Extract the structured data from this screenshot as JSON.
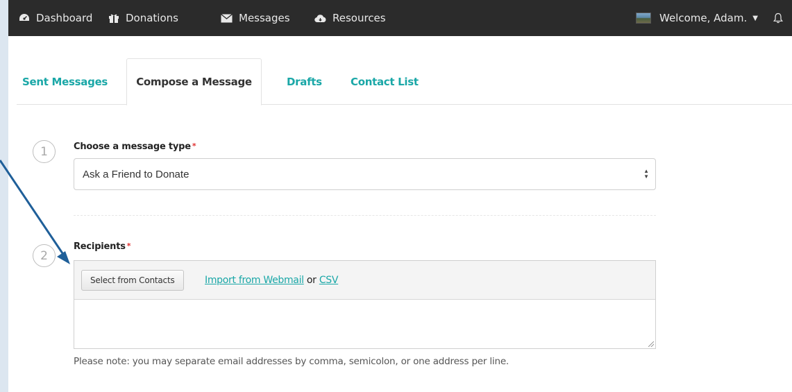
{
  "topnav": {
    "items": [
      {
        "label": "Dashboard",
        "icon": "dashboard-icon"
      },
      {
        "label": "Donations",
        "icon": "gift-icon"
      },
      {
        "label": "Messages",
        "icon": "envelope-icon"
      },
      {
        "label": "Resources",
        "icon": "cloud-icon"
      }
    ],
    "user_label": "Welcome, Adam.",
    "bell_icon": "bell-icon"
  },
  "tabs": [
    {
      "label": "Sent Messages",
      "active": false
    },
    {
      "label": "Compose a Message",
      "active": true
    },
    {
      "label": "Drafts",
      "active": false
    },
    {
      "label": "Contact List",
      "active": false
    }
  ],
  "form": {
    "step1": {
      "number": "1",
      "label": "Choose a message type",
      "required_mark": "*",
      "selected_value": "Ask a Friend to Donate"
    },
    "step2": {
      "number": "2",
      "label": "Recipients",
      "required_mark": "*",
      "select_button": "Select from Contacts",
      "import_webmail": "Import from Webmail",
      "or_text": "or",
      "import_csv": "CSV",
      "textarea_value": "",
      "help_text": "Please note: you may separate email addresses by comma, semicolon, or one address per line."
    }
  },
  "colors": {
    "accent": "#1aa7a7",
    "nav_bg": "#2b2b2b",
    "required": "#e03030",
    "annotation_arrow": "#1f5f99",
    "page_bg": "#dce6f0"
  }
}
